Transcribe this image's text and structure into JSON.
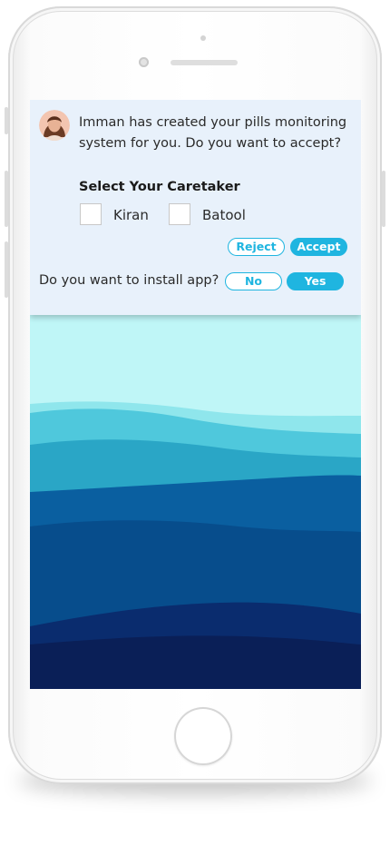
{
  "notification": {
    "message": "Imman has created your pills monitoring system for you. Do you want to accept?",
    "caretaker_title": "Select Your Caretaker",
    "caretakers": [
      "Kiran",
      "Batool"
    ],
    "reject_label": "Reject",
    "accept_label": "Accept",
    "install_question": "Do you want to install app?",
    "no_label": "No",
    "yes_label": "Yes"
  },
  "colors": {
    "accent": "#1fb5e0",
    "card_background": "#e8f1fb",
    "wave_light": "#bff6f7",
    "wave_dark": "#0a1f57"
  },
  "icons": [
    "avatar",
    "camera-icon",
    "speaker-icon",
    "home-button-icon"
  ]
}
